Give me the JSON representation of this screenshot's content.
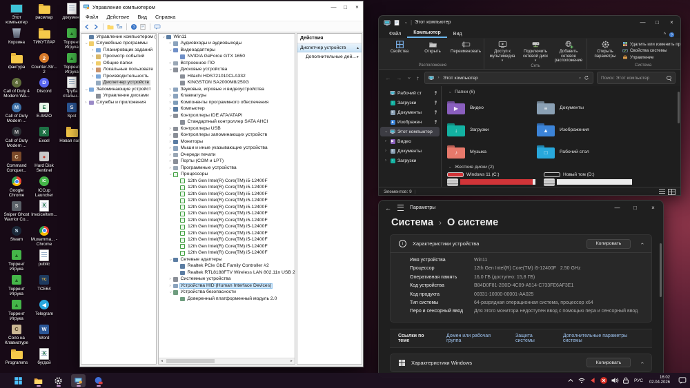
{
  "desktop": {
    "columns": [
      {
        "items": [
          {
            "label": "Этот компьютер",
            "icon": "this-pc"
          },
          {
            "label": "Корзина",
            "icon": "recycle-bin"
          },
          {
            "label": "фактура",
            "icon": "folder"
          },
          {
            "label": "Call of Duty 4 Modern Wa...",
            "icon": "game-cod4"
          },
          {
            "label": "Call of Duty Modern ...",
            "icon": "game-codmw"
          },
          {
            "label": "Call of Duty Modern ...",
            "icon": "game-codmw2"
          },
          {
            "label": "Command Conquer...",
            "icon": "game-cnc"
          },
          {
            "label": "Google Chrome",
            "icon": "chrome"
          },
          {
            "label": "Sniper Ghost Warrior Co...",
            "icon": "game-sniper"
          },
          {
            "label": "Steam",
            "icon": "steam"
          },
          {
            "label": "Торрент Игрука",
            "icon": "torrent"
          },
          {
            "label": "Торрент Игрука",
            "icon": "torrent"
          },
          {
            "label": "Торрент Игрука",
            "icon": "torrent"
          },
          {
            "label": "Соло на Клавиатуре",
            "icon": "solo-keyboard"
          },
          {
            "label": "Programms",
            "icon": "folder"
          }
        ]
      },
      {
        "items": [
          {
            "label": "расмлар",
            "icon": "folder"
          },
          {
            "label": "ТИКУТЛАР",
            "icon": "folder"
          },
          {
            "label": "Counter-Str... 2",
            "icon": "game-cs2"
          },
          {
            "label": "Discord",
            "icon": "discord"
          },
          {
            "label": "E-IMZO",
            "icon": "eimzo"
          },
          {
            "label": "Excel",
            "icon": "excel"
          },
          {
            "label": "Hard Disk Sentinel",
            "icon": "hdsentinel"
          },
          {
            "label": "ICCup Launcher",
            "icon": "iccup"
          },
          {
            "label": "InvoiceItem...",
            "icon": "excel-file"
          },
          {
            "label": "Muxamma... - Chrome",
            "icon": "chrome"
          },
          {
            "label": "public",
            "icon": "doc"
          },
          {
            "label": "TCE64",
            "icon": "tc64"
          },
          {
            "label": "Telegram",
            "icon": "telegram"
          },
          {
            "label": "Word",
            "icon": "word"
          },
          {
            "label": "бугдой",
            "icon": "excel-file"
          }
        ]
      },
      {
        "items": [
          {
            "label": "документ",
            "icon": "doc"
          },
          {
            "label": "Торрент Игрука",
            "icon": "torrent"
          },
          {
            "label": "Торрент Игрука",
            "icon": "torrent"
          },
          {
            "label": "Труба стальн...",
            "icon": "doc"
          },
          {
            "label": "Spot",
            "icon": "spot"
          },
          {
            "label": "Новая пап...",
            "icon": "folder"
          }
        ]
      }
    ]
  },
  "mmc": {
    "title": "Управление компьютером",
    "menu": [
      "Файл",
      "Действие",
      "Вид",
      "Справка"
    ],
    "left_tree": [
      {
        "d": 0,
        "exp": "",
        "icon": "computer",
        "label": "Управление компьютером (л"
      },
      {
        "d": 0,
        "exp": "v",
        "icon": "folder-tools",
        "label": "Служебные программы"
      },
      {
        "d": 1,
        "exp": ">",
        "icon": "task-scheduler",
        "label": "Планировщик заданий"
      },
      {
        "d": 1,
        "exp": ">",
        "icon": "event-viewer",
        "label": "Просмотр событий"
      },
      {
        "d": 1,
        "exp": ">",
        "icon": "shared-folders",
        "label": "Общие папки"
      },
      {
        "d": 1,
        "exp": ">",
        "icon": "local-users",
        "label": "Локальные пользовате"
      },
      {
        "d": 1,
        "exp": ">",
        "icon": "performance",
        "label": "Производительность"
      },
      {
        "d": 1,
        "exp": "",
        "icon": "device-manager",
        "label": "Диспетчер устройств",
        "selected": true
      },
      {
        "d": 0,
        "exp": "v",
        "icon": "storage",
        "label": "Запоминающие устройст"
      },
      {
        "d": 1,
        "exp": "",
        "icon": "disk-management",
        "label": "Управление дисками"
      },
      {
        "d": 0,
        "exp": ">",
        "icon": "services",
        "label": "Службы и приложения"
      }
    ],
    "device_tree": [
      {
        "d": 0,
        "exp": "v",
        "icon": "computer",
        "label": "Win11"
      },
      {
        "d": 1,
        "exp": ">",
        "icon": "audio",
        "label": "Аудиовходы и аудиовыходы"
      },
      {
        "d": 1,
        "exp": "v",
        "icon": "display",
        "label": "Видеоадаптеры"
      },
      {
        "d": 2,
        "exp": "",
        "icon": "display",
        "label": "NVIDIA GeForce GTX 1650"
      },
      {
        "d": 1,
        "exp": ">",
        "icon": "firmware",
        "label": "Встроенное ПО"
      },
      {
        "d": 1,
        "exp": "v",
        "icon": "disk",
        "label": "Дисковые устройства"
      },
      {
        "d": 2,
        "exp": "",
        "icon": "disk",
        "label": "Hitachi HDS721010CLA332"
      },
      {
        "d": 2,
        "exp": "",
        "icon": "disk",
        "label": "KINGSTON SA2000M8/250G"
      },
      {
        "d": 1,
        "exp": ">",
        "icon": "sound",
        "label": "Звуковые, игровые и видеоустройства"
      },
      {
        "d": 1,
        "exp": ">",
        "icon": "keyboard",
        "label": "Клавиатуры"
      },
      {
        "d": 1,
        "exp": ">",
        "icon": "software-comp",
        "label": "Компоненты программного обеспечения"
      },
      {
        "d": 1,
        "exp": ">",
        "icon": "computer",
        "label": "Компьютер"
      },
      {
        "d": 1,
        "exp": "v",
        "icon": "ide",
        "label": "Контроллеры IDE ATA/ATAPI"
      },
      {
        "d": 2,
        "exp": "",
        "icon": "ide",
        "label": "Стандартный контроллер SATA AHCI"
      },
      {
        "d": 1,
        "exp": ">",
        "icon": "usb",
        "label": "Контроллеры USB"
      },
      {
        "d": 1,
        "exp": ">",
        "icon": "storage-ctl",
        "label": "Контроллеры запоминающих устройств"
      },
      {
        "d": 1,
        "exp": ">",
        "icon": "monitor",
        "label": "Мониторы"
      },
      {
        "d": 1,
        "exp": ">",
        "icon": "mouse",
        "label": "Мыши и иные указывающие устройства"
      },
      {
        "d": 1,
        "exp": ">",
        "icon": "printer",
        "label": "Очереди печати"
      },
      {
        "d": 1,
        "exp": ">",
        "icon": "ports",
        "label": "Порты (COM и LPT)"
      },
      {
        "d": 1,
        "exp": ">",
        "icon": "software-dev",
        "label": "Программные устройства"
      },
      {
        "d": 1,
        "exp": "v",
        "icon": "cpu",
        "label": "Процессоры"
      },
      {
        "d": 2,
        "exp": "",
        "icon": "cpu",
        "label": "12th Gen Intel(R) Core(TM) i5-12400F",
        "repeat": 12
      },
      {
        "d": 1,
        "exp": "v",
        "icon": "network",
        "label": "Сетевые адаптеры"
      },
      {
        "d": 2,
        "exp": "",
        "icon": "network",
        "label": "Realtek PCIe GbE Family Controller #2"
      },
      {
        "d": 2,
        "exp": "",
        "icon": "network",
        "label": "Realtek RTL8188FTV Wireless LAN 802.11n USB 2.0 Network A"
      },
      {
        "d": 1,
        "exp": ">",
        "icon": "system-dev",
        "label": "Системные устройства"
      },
      {
        "d": 1,
        "exp": ">",
        "icon": "hid",
        "label": "Устройства HID (Human Interface Devices)",
        "selected": true
      },
      {
        "d": 1,
        "exp": "v",
        "icon": "security-dev",
        "label": "Устройства безопасности"
      },
      {
        "d": 2,
        "exp": "",
        "icon": "tpm",
        "label": "Доверенный платформенный модуль 2.0"
      }
    ],
    "actions": {
      "header": "Действия",
      "item": "Диспетчер устройств",
      "sub": "Дополнительные дей..."
    }
  },
  "explorer": {
    "title": "Этот компьютер",
    "tabs": [
      "Файл",
      "Компьютер",
      "Вид"
    ],
    "active_tab": "Компьютер",
    "ribbon": [
      {
        "group": "Расположение",
        "big": [
          {
            "label": "Свойства",
            "icon": "grid"
          },
          {
            "label": "Открыть",
            "icon": "openfold"
          },
          {
            "label": "Переименовать",
            "icon": "rename"
          }
        ]
      },
      {
        "group": "Сеть",
        "big": [
          {
            "label": "Доступ к мультимедиа",
            "icon": "medmon",
            "arrow": true
          },
          {
            "label": "Подключить сетевой диск",
            "icon": "netdrive",
            "arrow": true
          },
          {
            "label": "Добавить сетевое расположение",
            "icon": "addnet"
          }
        ]
      },
      {
        "group": "Система",
        "big": [
          {
            "label": "Открыть параметры",
            "icon": "geardark"
          }
        ],
        "small": [
          {
            "label": "Удалить или изменить программу",
            "icon": "progs"
          },
          {
            "label": "Свойства системы",
            "icon": "syscheck"
          },
          {
            "label": "Управление",
            "icon": "toolbox"
          }
        ]
      }
    ],
    "nav": {
      "address": "Этот компьютер",
      "search_placeholder": "Поиск: Этот компьютер"
    },
    "sidebar": [
      {
        "label": "Рабочий ст",
        "icon": "desktop",
        "pinned": true
      },
      {
        "label": "Загрузки",
        "icon": "downloads",
        "pinned": true
      },
      {
        "label": "Документы",
        "icon": "documents",
        "pinned": true
      },
      {
        "label": "Изображен",
        "icon": "pictures",
        "pinned": true
      },
      {
        "label": "Этот компьютер",
        "icon": "this-pc",
        "selected": true,
        "exp": "v"
      },
      {
        "label": "Видео",
        "icon": "videos",
        "exp": ">"
      },
      {
        "label": "Документы",
        "icon": "documents",
        "exp": ">"
      },
      {
        "label": "Загрузки",
        "icon": "downloads",
        "exp": ">"
      }
    ],
    "folders_header": "Папки (6)",
    "folders": [
      {
        "label": "Видео",
        "icon": "videos"
      },
      {
        "label": "Загрузки",
        "icon": "downloads"
      },
      {
        "label": "Музыка",
        "icon": "music"
      },
      {
        "label": "Документы",
        "icon": "documents"
      },
      {
        "label": "Изображения",
        "icon": "pictures"
      },
      {
        "label": "Рабочий стол",
        "icon": "desktop"
      }
    ],
    "disks_header": "Жесткие диски (2)",
    "disks": [
      {
        "label": "Windows 11 (C:)",
        "fill": 96,
        "color": "#d13438",
        "pill": "#d13438"
      },
      {
        "label": "Новый том (D:)",
        "fill": 0,
        "color": "#ececec",
        "pill": "none"
      }
    ],
    "status": "Элементов: 9"
  },
  "settings": {
    "title": "Параметры",
    "breadcrumb": {
      "root": "Система",
      "sep": "›",
      "page": "О системе"
    },
    "card1": {
      "title": "Характеристики устройства",
      "button": "Копировать"
    },
    "specs": [
      {
        "label": "Имя устройства",
        "value": "Win11"
      },
      {
        "label": "Процессор",
        "value": "12th Gen Intel(R) Core(TM) i5-12400F   2.50 GHz"
      },
      {
        "label": "Оперативная память",
        "value": "16,0 ГБ (доступно: 15,8 ГБ)"
      },
      {
        "label": "Код устройства",
        "value": "B84D0F81-2B0D-4C09-A514-C733FE6AF3E1"
      },
      {
        "label": "Код продукта",
        "value": "00331-10000-00001-AA025"
      },
      {
        "label": "Тип системы",
        "value": "64-разрядная операционная система, процессор x64"
      },
      {
        "label": "Перо и сенсорный ввод",
        "value": "Для этого монитора недоступен ввод с помощью пера и сенсорный ввод"
      }
    ],
    "links_label": "Ссылки по теме",
    "links": [
      "Домен или рабочая группа",
      "Защита системы",
      "Дополнительные параметры системы"
    ],
    "card2": {
      "title": "Характеристики Windows",
      "button": "Копировать"
    }
  },
  "taskbar": {
    "apps": [
      {
        "icon": "start",
        "name": "start-button",
        "running": false
      },
      {
        "icon": "explorer",
        "name": "taskbar-explorer",
        "running": true
      },
      {
        "icon": "settings",
        "name": "taskbar-settings",
        "running": true
      },
      {
        "icon": "mmc",
        "name": "taskbar-computer-management",
        "running": true,
        "focused": true
      },
      {
        "icon": "app-blue",
        "name": "taskbar-app",
        "running": true
      }
    ],
    "tray": {
      "lang": "РУС",
      "time": "16:02",
      "date": "02.04.2026"
    }
  },
  "colors": {
    "c_drive_fill": "#d13438",
    "selection_blue": "#cde8ff",
    "tab_accent": "#6cb8f0",
    "link": "#9cc0ec",
    "desktop_maroon": "#8a3448"
  }
}
